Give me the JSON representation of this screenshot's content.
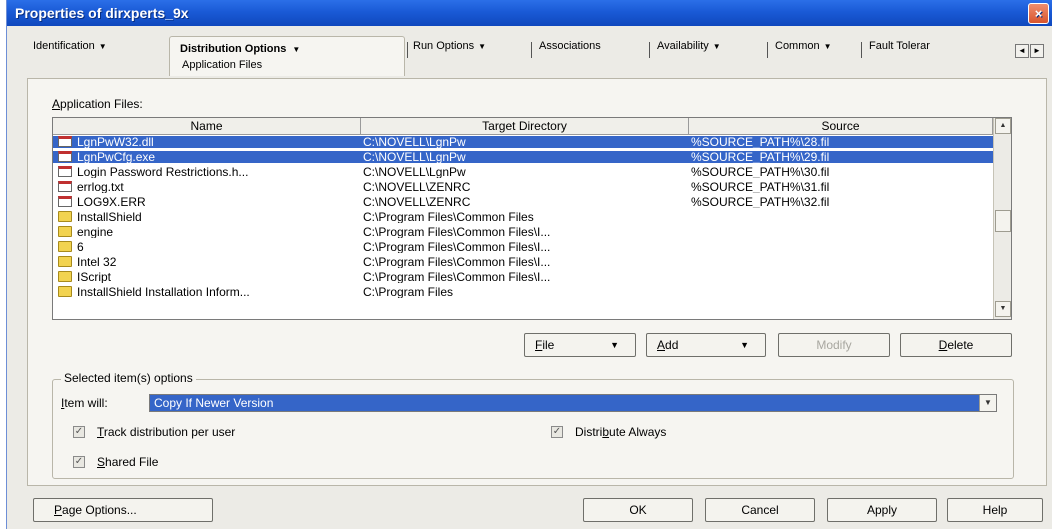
{
  "window": {
    "title": "Properties of dirxperts_9x",
    "close_glyph": "×"
  },
  "tabs": {
    "items": [
      {
        "label": "Identification",
        "arrow": "▼"
      },
      {
        "label": "Distribution Options",
        "arrow": "▼",
        "sub": "Application Files"
      },
      {
        "label": "Run Options",
        "arrow": "▼"
      },
      {
        "label": "Associations"
      },
      {
        "label": "Availability",
        "arrow": "▼"
      },
      {
        "label": "Common",
        "arrow": "▼"
      },
      {
        "label": "Fault Tolerar"
      }
    ],
    "scroll_left": "◄",
    "scroll_right": "►"
  },
  "files": {
    "label_prefix": "A",
    "label_rest": "pplication Files:",
    "columns": [
      "Name",
      "Target Directory",
      "Source"
    ],
    "rows": [
      {
        "icon": "doc-icon",
        "name": "LgnPwW32.dll",
        "target": "C:\\NOVELL\\LgnPw",
        "source": "%SOURCE_PATH%\\28.fil",
        "selected": true
      },
      {
        "icon": "doc-icon",
        "name": "LgnPwCfg.exe",
        "target": "C:\\NOVELL\\LgnPw",
        "source": "%SOURCE_PATH%\\29.fil",
        "selected": true
      },
      {
        "icon": "doc-icon",
        "name": "Login Password Restrictions.h...",
        "target": "C:\\NOVELL\\LgnPw",
        "source": "%SOURCE_PATH%\\30.fil",
        "selected": false
      },
      {
        "icon": "doc-icon",
        "name": "errlog.txt",
        "target": "C:\\NOVELL\\ZENRC",
        "source": "%SOURCE_PATH%\\31.fil",
        "selected": false
      },
      {
        "icon": "doc-icon",
        "name": "LOG9X.ERR",
        "target": "C:\\NOVELL\\ZENRC",
        "source": "%SOURCE_PATH%\\32.fil",
        "selected": false
      },
      {
        "icon": "folder-icon",
        "name": "InstallShield",
        "target": "C:\\Program Files\\Common Files",
        "source": "",
        "selected": false
      },
      {
        "icon": "folder-icon",
        "name": "engine",
        "target": "C:\\Program Files\\Common Files\\I...",
        "source": "",
        "selected": false
      },
      {
        "icon": "folder-icon",
        "name": "6",
        "target": "C:\\Program Files\\Common Files\\I...",
        "source": "",
        "selected": false
      },
      {
        "icon": "folder-icon",
        "name": "Intel 32",
        "target": "C:\\Program Files\\Common Files\\I...",
        "source": "",
        "selected": false
      },
      {
        "icon": "folder-icon",
        "name": "IScript",
        "target": "C:\\Program Files\\Common Files\\I...",
        "source": "",
        "selected": false
      },
      {
        "icon": "folder-icon",
        "name": "InstallShield Installation Inform...",
        "target": "C:\\Program Files",
        "source": "",
        "selected": false
      }
    ],
    "scroll_up": "▲",
    "scroll_down": "▼"
  },
  "actions": {
    "file_first": "F",
    "file_rest": "ile",
    "add_first": "A",
    "add_rest": "dd",
    "modify": "Modify",
    "delete_first": "D",
    "delete_rest": "elete",
    "dropdown_arrow": "▼"
  },
  "options": {
    "group_title": "Selected item(s) options",
    "item_will_first": "I",
    "item_will_rest": "tem will:",
    "item_will_value": "Copy If Newer Version",
    "track_first": "T",
    "track_rest": "rack distribution per user",
    "distribute_before": "Distri",
    "distribute_u": "b",
    "distribute_after": "ute Always",
    "shared_first": "S",
    "shared_rest": "hared File",
    "check_glyph": "✓"
  },
  "footer": {
    "page_options_first": "P",
    "page_options_rest": "age Options...",
    "ok": "OK",
    "cancel": "Cancel",
    "apply": "Apply",
    "help": "Help"
  },
  "colors": {
    "title_bar": "#1a5ad6",
    "selection": "#3565c8",
    "dialog_bg": "#ecebe6"
  }
}
